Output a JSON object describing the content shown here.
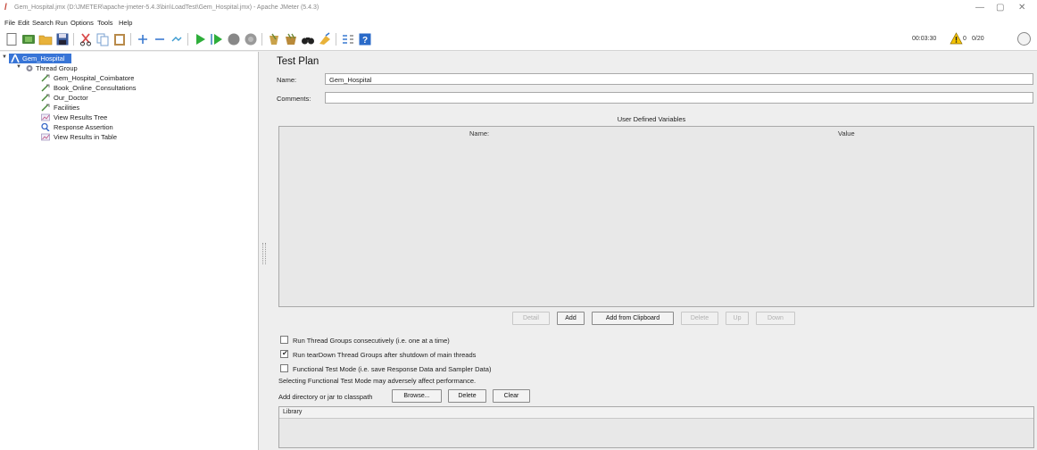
{
  "window": {
    "title": "Gem_Hospital.jmx (D:\\JMETER\\apache-jmeter-5.4.3\\bin\\LoadTest\\Gem_Hospital.jmx) - Apache JMeter (5.4.3)",
    "controls": [
      "—",
      "▢",
      "✕"
    ]
  },
  "menu": [
    "File",
    "Edit",
    "Search",
    "Run",
    "Options",
    "Tools",
    "Help"
  ],
  "toolbar": {
    "elapsed_time": "00:03:30",
    "error_count": "0",
    "threads": "0/20"
  },
  "tree": {
    "root": "Gem_Hospital",
    "thread_group": "Thread Group",
    "children": [
      {
        "label": "Gem_Hospital_Coimbatore",
        "icon": "http-sampler-icon"
      },
      {
        "label": "Book_Online_Consultations",
        "icon": "http-sampler-icon"
      },
      {
        "label": "Our_Doctor",
        "icon": "http-sampler-icon"
      },
      {
        "label": "Facilities",
        "icon": "http-sampler-icon"
      },
      {
        "label": "View Results Tree",
        "icon": "listener-icon"
      },
      {
        "label": "Response Assertion",
        "icon": "assertion-icon"
      },
      {
        "label": "View Results in Table",
        "icon": "listener-icon"
      }
    ]
  },
  "main": {
    "title": "Test Plan",
    "name_label": "Name:",
    "name_value": "Gem_Hospital",
    "comments_label": "Comments:",
    "comments_value": "",
    "vars_title": "User Defined Variables",
    "columns": [
      "Name:",
      "Value"
    ],
    "buttons": {
      "detail": "Detail",
      "add": "Add",
      "add_clipboard": "Add from Clipboard",
      "delete": "Delete",
      "up": "Up",
      "down": "Down"
    },
    "options": [
      {
        "label": "Run Thread Groups consecutively (i.e. one at a time)",
        "checked": false
      },
      {
        "label": "Run tearDown Thread Groups after shutdown of main threads",
        "checked": true
      },
      {
        "label": "Functional Test Mode (i.e. save Response Data and Sampler Data)",
        "checked": false
      }
    ],
    "functional_note": "Selecting Functional Test Mode may adversely affect performance.",
    "classpath_label": "Add directory or jar to classpath",
    "classpath_buttons": {
      "browse": "Browse...",
      "delete": "Delete",
      "clear": "Clear"
    },
    "library_header": "Library"
  },
  "colors": {
    "selection": "#3875d7",
    "panel": "#eeeeee",
    "accent_warning": "#f5c400"
  }
}
